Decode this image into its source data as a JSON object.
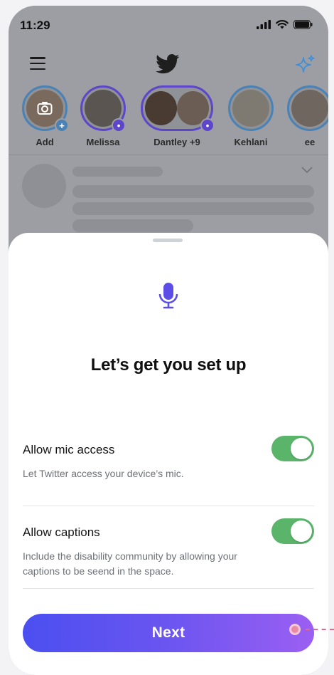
{
  "status_bar": {
    "time": "11:29"
  },
  "fleets": [
    {
      "label": "Add"
    },
    {
      "label": "Melissa"
    },
    {
      "label": "Dantley +9"
    },
    {
      "label": "Kehlani"
    },
    {
      "label": "ee"
    }
  ],
  "sheet": {
    "title": "Let’s get you set up",
    "settings": [
      {
        "title": "Allow mic access",
        "description": "Let Twitter access your device’s mic.",
        "enabled": true
      },
      {
        "title": "Allow captions",
        "description": "Include the disability community by allowing your captions to be seend in the space.",
        "enabled": true
      }
    ],
    "next_label": "Next"
  },
  "icons": {
    "menu": "hamburger-icon",
    "logo": "twitter-bird-icon",
    "sparkle": "sparkle-icon",
    "mic": "microphone-icon",
    "chevron": "chevron-down-icon"
  },
  "colors": {
    "accent_purple": "#5b4de6",
    "toggle_on": "#5ab56b",
    "twitter_blue": "#3f8fd8"
  }
}
